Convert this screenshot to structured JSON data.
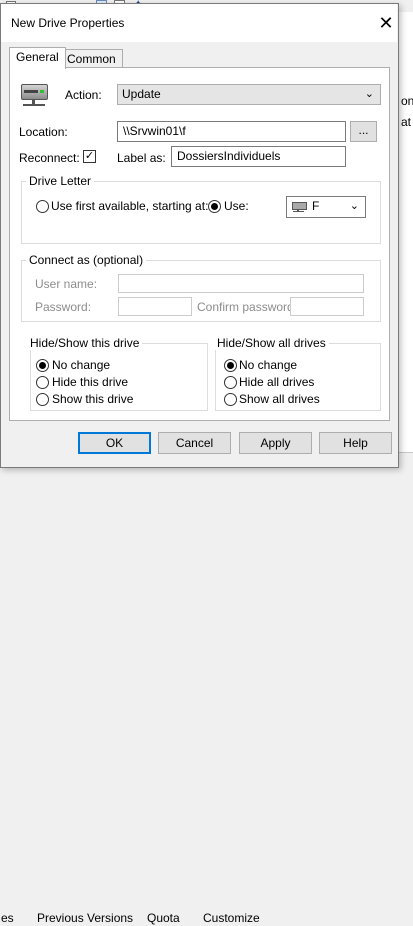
{
  "window": {
    "title": "New Drive Properties"
  },
  "tabs": [
    {
      "label": "General",
      "active": true
    },
    {
      "label": "Common",
      "active": false
    }
  ],
  "general": {
    "action_label": "Action:",
    "action_value": "Update",
    "location_label": "Location:",
    "location_value": "\\\\Srvwin01\\f",
    "browse_label": "...",
    "reconnect_label": "Reconnect:",
    "reconnect_checked": true,
    "label_as_label": "Label as:",
    "label_as_value": "DossiersIndividuels"
  },
  "drive_letter": {
    "group_label": "Drive Letter",
    "use_first_label": "Use first available, starting at:",
    "use_label": "Use:",
    "selected": "use",
    "drive_value": "F"
  },
  "connect_as": {
    "group_label": "Connect as (optional)",
    "user_name_label": "User name:",
    "password_label": "Password:",
    "confirm_password_label": "Confirm password:"
  },
  "hide_show_drive": {
    "group_label": "Hide/Show this drive",
    "options": [
      "No change",
      "Hide this drive",
      "Show this drive"
    ],
    "selected": 0
  },
  "hide_show_all": {
    "group_label": "Hide/Show all drives",
    "options": [
      "No change",
      "Hide all drives",
      "Show all drives"
    ],
    "selected": 0
  },
  "buttons": {
    "ok": "OK",
    "cancel": "Cancel",
    "apply": "Apply",
    "help": "Help"
  },
  "background": {
    "right_fragments": [
      "on",
      "at"
    ],
    "bottom_tabs": [
      "es",
      "Previous Versions",
      "Quota",
      "Customize"
    ]
  }
}
